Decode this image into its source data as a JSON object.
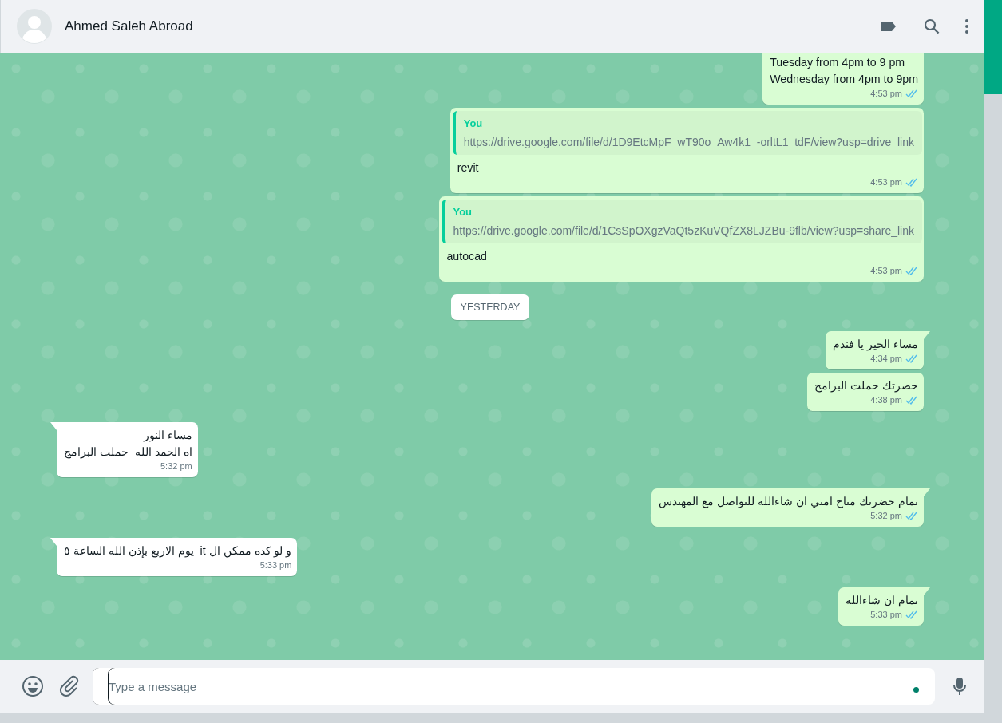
{
  "header": {
    "contact_name": "Ahmed Saleh Abroad"
  },
  "messages": [
    {
      "kind": "outgoing",
      "lines": [
        "Tuesday from 4pm to 9 pm",
        "Wednesday from 4pm to 9pm"
      ],
      "time": "4:53 pm",
      "read": true
    },
    {
      "kind": "quoted",
      "quote_author": "You",
      "quote_text": "https://drive.google.com/file/d/1D9EtcMpF_wT90o_Aw4k1_-orltL1_tdF/view?usp=drive_link",
      "lines": [
        "revit"
      ],
      "time": "4:53 pm",
      "read": true
    },
    {
      "kind": "quoted",
      "quote_author": "You",
      "quote_text": "https://drive.google.com/file/d/1CsSpOXgzVaQt5zKuVQfZX8LJZBu-9flb/view?usp=share_link",
      "lines": [
        "autocad"
      ],
      "time": "4:53 pm",
      "read": true
    },
    {
      "kind": "date",
      "label": "YESTERDAY"
    },
    {
      "kind": "outgoing",
      "lines": [
        "مساء الخير يا فندم"
      ],
      "time": "4:34 pm",
      "read": true
    },
    {
      "kind": "outgoing",
      "lines": [
        "حضرتك حملت البرامج"
      ],
      "time": "4:38 pm",
      "read": true
    },
    {
      "kind": "incoming",
      "lines": [
        "مساء النور",
        "اه الحمد الله  حملت البرامج"
      ],
      "time": "5:32 pm"
    },
    {
      "kind": "outgoing",
      "lines": [
        "تمام حضرتك متاح امتي ان شاءالله للتواصل مع المهندس"
      ],
      "time": "5:32 pm",
      "read": true
    },
    {
      "kind": "incoming",
      "lines": [
        "و لو كده ممكن ال it  يوم الاربع بإذن الله الساعة ٥"
      ],
      "time": "5:33 pm"
    },
    {
      "kind": "outgoing",
      "lines": [
        "تمام ان شاءالله"
      ],
      "time": "5:33 pm",
      "read": true
    }
  ],
  "composer": {
    "placeholder": "Type a message"
  }
}
